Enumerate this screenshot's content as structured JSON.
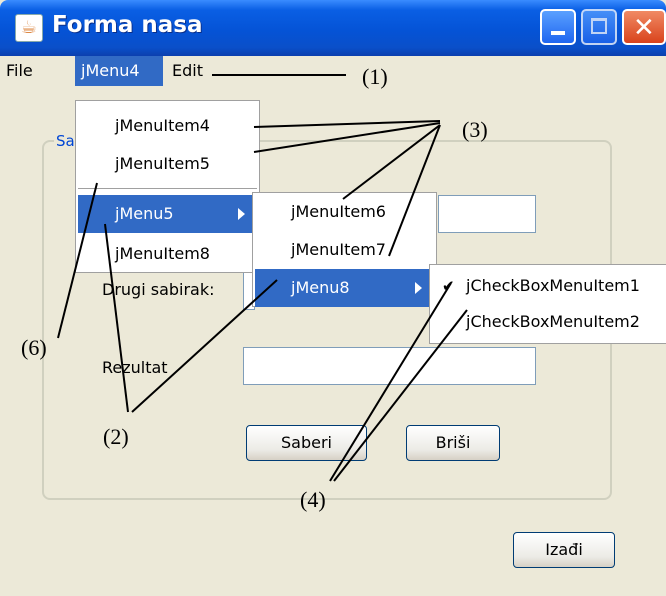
{
  "window": {
    "title": "Forma nasa"
  },
  "menubar": {
    "items": [
      "File",
      "jMenu4",
      "Edit"
    ]
  },
  "menu_jMenu4": {
    "items": [
      "jMenuItem4",
      "jMenuItem5",
      "jMenu5",
      "jMenuItem8"
    ]
  },
  "menu_jMenu5": {
    "items": [
      "jMenuItem6",
      "jMenuItem7",
      "jMenu8"
    ]
  },
  "menu_jMenu8": {
    "items": [
      "jCheckBoxMenuItem1",
      "jCheckBoxMenuItem2"
    ],
    "checked": [
      true,
      false
    ]
  },
  "form": {
    "group_label": "Sa",
    "label_second": "Drugi sabirak:",
    "label_result": "Rezultat",
    "btn_add": "Saberi",
    "btn_clear": "Briši",
    "btn_exit": "Izađi"
  },
  "annotations": {
    "a1": "(1)",
    "a2": "(2)",
    "a3": "(3)",
    "a4": "(4)",
    "a6": "(6)"
  },
  "colors": {
    "selection": "#316ac5",
    "titlebar": "#0553d6",
    "window_bg": "#ece9d8"
  }
}
